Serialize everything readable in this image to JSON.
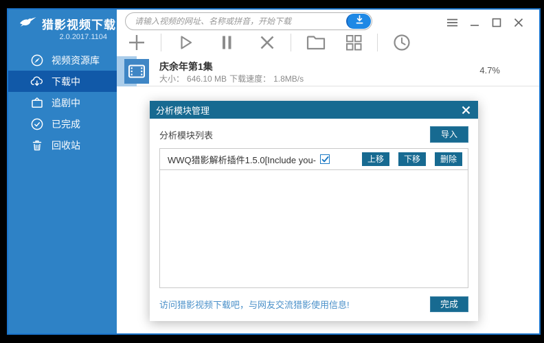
{
  "app": {
    "title": "猎影视频下载",
    "version": "2.0.2017.1104"
  },
  "search": {
    "placeholder": "请输入视频的网址、名称或拼音，开始下载"
  },
  "sidebar": {
    "items": [
      {
        "label": "视频资源库",
        "icon": "compass-icon",
        "active": false
      },
      {
        "label": "下载中",
        "icon": "cloud-download-icon",
        "active": true
      },
      {
        "label": "追剧中",
        "icon": "tv-icon",
        "active": false
      },
      {
        "label": "已完成",
        "icon": "check-circle-icon",
        "active": false
      },
      {
        "label": "回收站",
        "icon": "trash-icon",
        "active": false
      }
    ]
  },
  "toolbar": {
    "icons": [
      "add-icon",
      "play-icon",
      "pause-icon",
      "cancel-icon",
      "folder-icon",
      "grid-icon",
      "history-icon"
    ]
  },
  "download_item": {
    "title": "庆余年第1集",
    "size_label": "大小：",
    "size_value": "646.10 MB",
    "speed_label": "下载速度：",
    "speed_value": "1.8MB/s",
    "progress": "4.7%"
  },
  "modal": {
    "title": "分析模块管理",
    "list_label": "分析模块列表",
    "import_button": "导入",
    "plugins": [
      {
        "name": "WWQ猎影解析插件1.5.0[Include you-",
        "checked": true,
        "move_up_button": "上移",
        "move_down_button": "下移",
        "delete_button": "删除"
      }
    ],
    "footer_link": "访问猎影视频下载吧，与网友交流猎影使用信息!",
    "done_button": "完成"
  },
  "colors": {
    "sidebar_blue": "#2e82c6",
    "active_item_blue": "#1159a8",
    "window_border_blue": "#1a74cb",
    "modal_teal": "#176a91",
    "search_button_blue": "#1e88e5",
    "progress_fill_blue": "#abcdea",
    "link_blue": "#4a90c9"
  }
}
